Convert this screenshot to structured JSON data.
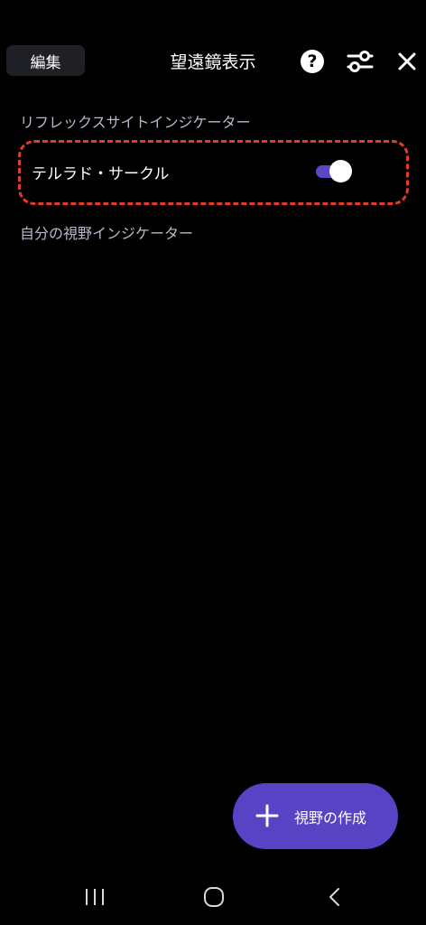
{
  "header": {
    "edit_label": "編集",
    "title": "望遠鏡表示",
    "help_glyph": "?"
  },
  "sections": {
    "reflex_heading": "リフレックスサイトインジケーター",
    "reflex_items": [
      {
        "label": "テルラド・サークル",
        "enabled": true
      }
    ],
    "own_heading": "自分の視野インジケーター"
  },
  "fab": {
    "label": "視野の作成",
    "icon": "plus-icon"
  },
  "navbar": {
    "icons": [
      "recents-icon",
      "home-icon",
      "back-icon"
    ]
  },
  "colors": {
    "background": "#000000",
    "accent": "#5843c4",
    "highlight": "#e23b2a",
    "muted_text": "#b9b9cc"
  }
}
